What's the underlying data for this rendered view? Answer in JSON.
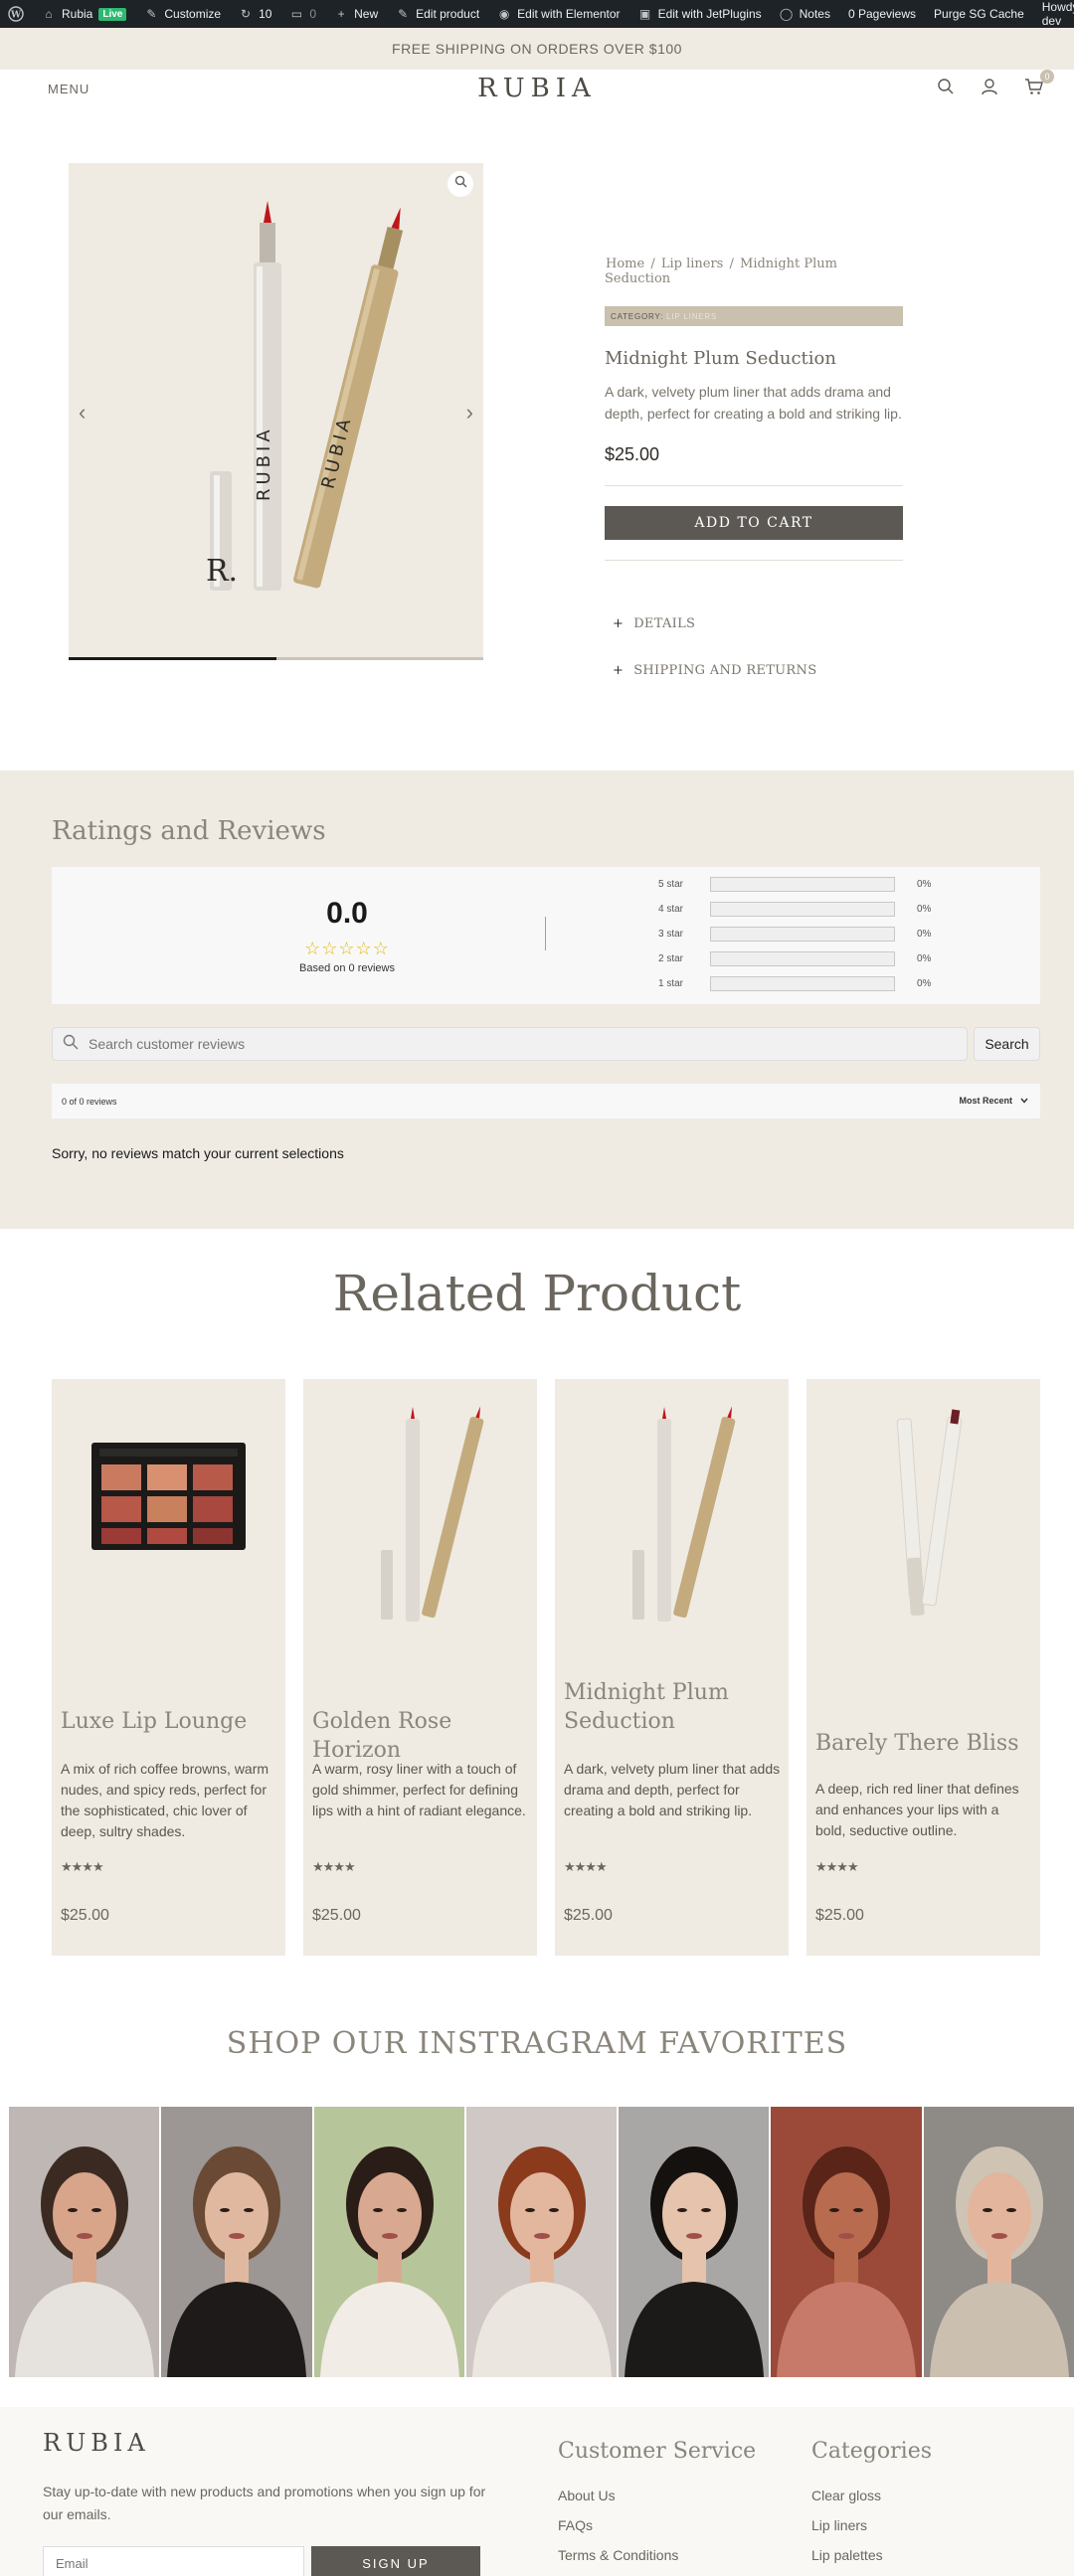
{
  "admin_bar": {
    "site_name": "Rubia",
    "live_badge": "Live",
    "customize": "Customize",
    "updates_count": "10",
    "comments_count": "0",
    "new": "New",
    "edit_product": "Edit product",
    "edit_elementor": "Edit with Elementor",
    "edit_jetplugins": "Edit with JetPlugins",
    "notes": "Notes",
    "pageviews": "0 Pageviews",
    "purge_cache": "Purge SG Cache",
    "howdy": "Howdy, dev"
  },
  "promo_banner": "FREE SHIPPING ON ORDERS OVER $100",
  "header": {
    "menu": "MENU",
    "logo": "RUBIA",
    "cart_count": "0"
  },
  "gallery": {
    "progress": 0.5,
    "colors": {
      "white_pen": "#d8d4cc",
      "gold_pen": "#c4ab7e",
      "tip": "#c0161a"
    }
  },
  "product": {
    "breadcrumb": [
      "Home",
      "Lip liners",
      "Midnight Plum Seduction"
    ],
    "category_label": "CATEGORY:",
    "category_value": "LIP LINERS",
    "title": "Midnight Plum Seduction",
    "description": "A dark, velvety plum liner that adds drama and depth, perfect for creating a bold and striking lip.",
    "price": "$25.00",
    "add_to_cart": "ADD TO CART",
    "accordion": [
      "DETAILS",
      "SHIPPING AND RETURNS"
    ]
  },
  "reviews": {
    "title": "Ratings and Reviews",
    "average": "0.0",
    "stars": "☆☆☆☆☆",
    "based_on": "Based on 0 reviews",
    "breakdown": [
      {
        "label": "5 star",
        "fraction": 0,
        "pct": "0%"
      },
      {
        "label": "4 star",
        "fraction": 0,
        "pct": "0%"
      },
      {
        "label": "3 star",
        "fraction": 0,
        "pct": "0%"
      },
      {
        "label": "2 star",
        "fraction": 0,
        "pct": "0%"
      },
      {
        "label": "1 star",
        "fraction": 0,
        "pct": "0%"
      }
    ],
    "search_placeholder": "Search customer reviews",
    "search_button": "Search",
    "count_text": "0 of 0 reviews",
    "sort_label": "Most Recent",
    "empty_message": "Sorry, no reviews match your current selections"
  },
  "related": {
    "title": "Related Product",
    "products": [
      {
        "title": "Luxe Lip Lounge",
        "description": "A mix of rich coffee browns, warm nudes, and spicy reds, perfect for the sophisticated, chic lover of deep, sultry shades.",
        "rating": "★★★★",
        "price": "$25.00",
        "image": "eyeshadow-palette"
      },
      {
        "title": "Golden Rose Horizon",
        "description": "A warm, rosy liner with a touch of gold shimmer, perfect for defining lips with a hint of radiant elegance.",
        "rating": "★★★★",
        "price": "$25.00",
        "image": "lip-liner-pair"
      },
      {
        "title": "Midnight Plum Seduction",
        "description": "A dark, velvety plum liner that adds drama and depth, perfect for creating a bold and striking lip.",
        "rating": "★★★★",
        "price": "$25.00",
        "image": "lip-liner-pair"
      },
      {
        "title": "Barely There Bliss",
        "description": "A deep, rich red liner that defines and enhances your lips with a bold, seductive outline.",
        "rating": "★★★★",
        "price": "$25.00",
        "image": "white-liner-pair"
      }
    ]
  },
  "instagram": {
    "title": "SHOP OUR INSTRAGRAM FAVORITES",
    "tiles": [
      {
        "name": "insta-photo-1",
        "bg": "#bfb7b3",
        "skin": "#d8a48a",
        "hair": "#3a2a22",
        "cloth": "#e6e2de"
      },
      {
        "name": "insta-photo-2",
        "bg": "#9c9694",
        "skin": "#e0b8a0",
        "hair": "#6a4a34",
        "cloth": "#1e1a1a"
      },
      {
        "name": "insta-photo-3",
        "bg": "#b7c59a",
        "skin": "#d9a890",
        "hair": "#2a1c16",
        "cloth": "#f1ece6"
      },
      {
        "name": "insta-photo-4",
        "bg": "#cfc8c4",
        "skin": "#e3b79e",
        "hair": "#8b3a1c",
        "cloth": "#ece6e0"
      },
      {
        "name": "insta-photo-5",
        "bg": "#a9a7a6",
        "skin": "#e6c3ad",
        "hair": "#15110f",
        "cloth": "#1c1a18"
      },
      {
        "name": "insta-photo-6",
        "bg": "#9b4a3a",
        "skin": "#b86b4e",
        "hair": "#5a2418",
        "cloth": "#c87a6a"
      },
      {
        "name": "insta-photo-7",
        "bg": "#8e8a86",
        "skin": "#e2b59c",
        "hair": "#cfc3b4",
        "cloth": "#cbbfb0"
      }
    ]
  },
  "footer": {
    "logo": "RUBIA",
    "newsletter_text": "Stay up-to-date with new products and promotions when you sign up for our emails.",
    "email_placeholder": "Email",
    "signup": "SIGN UP",
    "customer_service": {
      "title": "Customer Service",
      "links": [
        "About Us",
        "FAQs",
        "Terms & Conditions"
      ]
    },
    "categories": {
      "title": "Categories",
      "links": [
        "Clear gloss",
        "Lip liners",
        "Lip palettes"
      ]
    }
  }
}
